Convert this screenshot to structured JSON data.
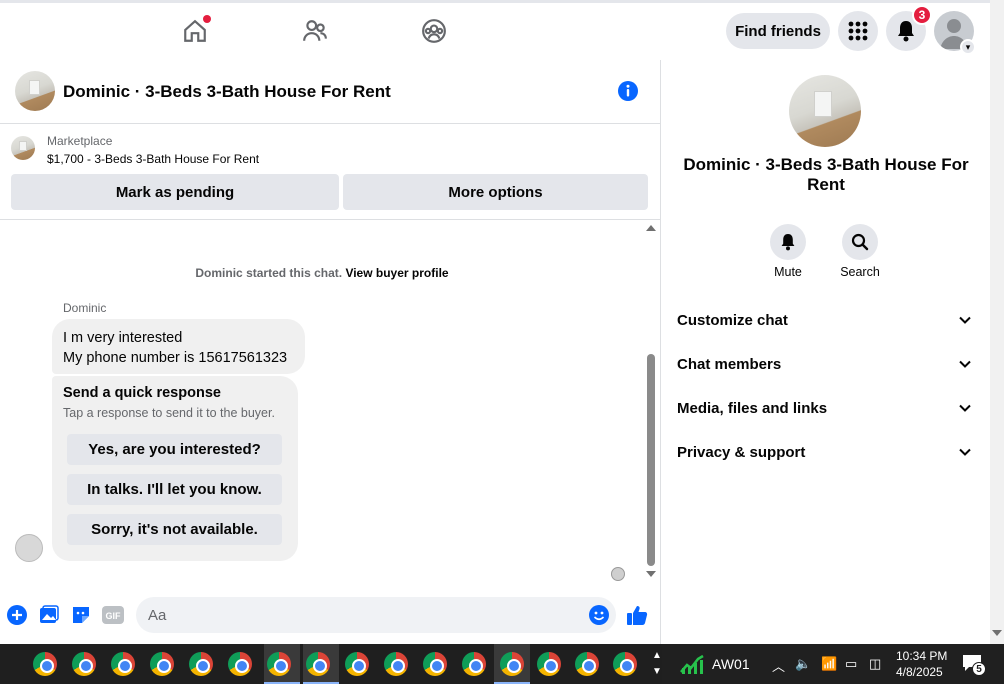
{
  "topnav": {
    "find_friends_label": "Find friends",
    "notification_count": "3"
  },
  "chat": {
    "title": "Dominic · 3-Beds 3-Bath House For Rent",
    "listing": {
      "label": "Marketplace",
      "price_title": "$1,700 - 3-Beds 3-Bath House For Rent"
    },
    "actions": {
      "mark_pending": "Mark as pending",
      "more_options": "More options"
    },
    "started_text": "Dominic started this chat.",
    "view_profile": "View buyer profile",
    "sender_name": "Dominic",
    "message_line1": "I m very interested",
    "message_line2": "My phone number is 15617561323",
    "quick_response": {
      "title": "Send a quick response",
      "subtitle": "Tap a response to send it to the buyer.",
      "options": [
        "Yes, are you interested?",
        "In talks. I'll let you know.",
        "Sorry, it's not available."
      ]
    },
    "composer": {
      "placeholder": "Aa",
      "gif_label": "GIF"
    }
  },
  "side": {
    "title": "Dominic · 3-Beds 3-Bath House For Rent",
    "mute_label": "Mute",
    "search_label": "Search",
    "sections": [
      "Customize chat",
      "Chat members",
      "Media, files and links",
      "Privacy & support"
    ]
  },
  "taskbar": {
    "stock_label": "AW01",
    "time": "10:34 PM",
    "date": "4/8/2025",
    "notification_count": "5"
  },
  "colors": {
    "accent": "#0866ff",
    "badge": "#e41e3f",
    "button_bg": "#e4e6eb"
  }
}
